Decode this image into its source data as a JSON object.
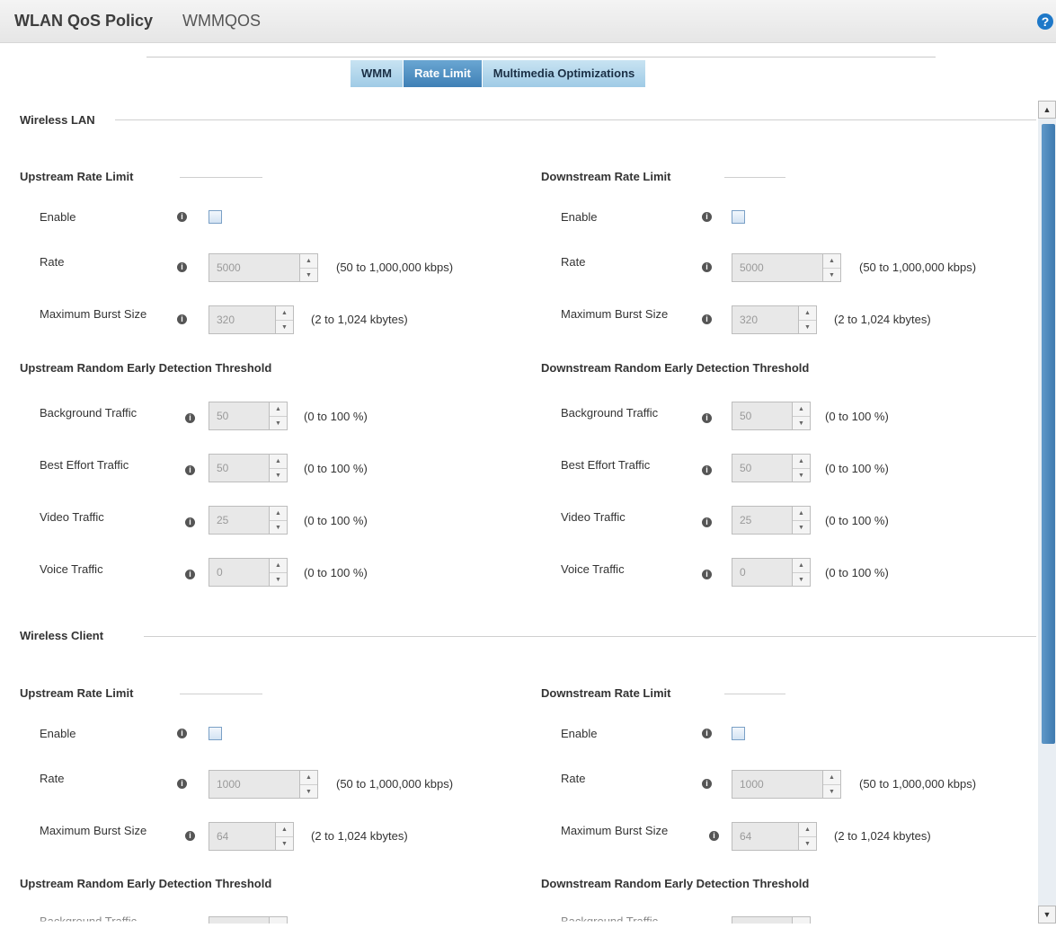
{
  "header": {
    "title": "WLAN QoS Policy",
    "policy_name": "WMMQOS",
    "help_icon": "help-icon"
  },
  "tabs": [
    {
      "label": "WMM",
      "active": false
    },
    {
      "label": "Rate Limit",
      "active": true
    },
    {
      "label": "Multimedia Optimizations",
      "active": false
    }
  ],
  "labels": {
    "enable": "Enable",
    "rate": "Rate",
    "max_burst": "Maximum Burst Size",
    "background": "Background Traffic",
    "best_effort": "Best Effort Traffic",
    "video": "Video Traffic",
    "voice": "Voice Traffic"
  },
  "hints": {
    "rate": "(50 to 1,000,000 kbps)",
    "burst": "(2 to 1,024 kbytes)",
    "percent": "(0 to 100 %)"
  },
  "wireless_lan": {
    "title": "Wireless LAN",
    "upstream": {
      "title": "Upstream Rate Limit",
      "enabled": false,
      "rate": "5000",
      "burst": "320",
      "red_title": "Upstream Random Early Detection Threshold",
      "background": "50",
      "best_effort": "50",
      "video": "25",
      "voice": "0"
    },
    "downstream": {
      "title": "Downstream Rate Limit",
      "enabled": false,
      "rate": "5000",
      "burst": "320",
      "red_title": "Downstream Random Early Detection Threshold",
      "background": "50",
      "best_effort": "50",
      "video": "25",
      "voice": "0"
    }
  },
  "wireless_client": {
    "title": "Wireless Client",
    "upstream": {
      "title": "Upstream Rate Limit",
      "enabled": false,
      "rate": "1000",
      "burst": "64",
      "red_title": "Upstream Random Early Detection Threshold"
    },
    "downstream": {
      "title": "Downstream Rate Limit",
      "enabled": false,
      "rate": "1000",
      "burst": "64",
      "red_title": "Downstream Random Early Detection Threshold"
    }
  },
  "colors": {
    "accent": "#3f80b6",
    "tab_inactive": "#9fcbe6",
    "help": "#1e78c8"
  }
}
